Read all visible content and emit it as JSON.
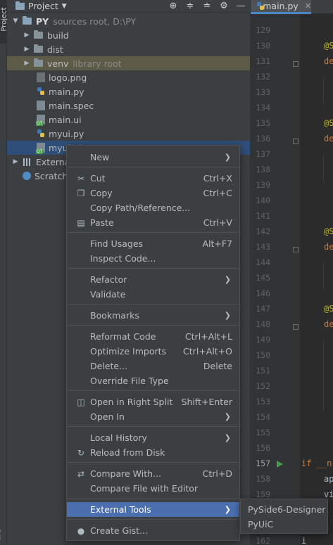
{
  "tool_strip": {
    "project_label": "Project",
    "bottom_label": "ure"
  },
  "panel": {
    "title": "Project",
    "tools": {
      "locate": "⊕",
      "expand": "≑",
      "collapse": "≐",
      "settings": "⚙",
      "hide": "—"
    }
  },
  "tree": {
    "root": {
      "name": "PY",
      "detail": "sources root,  D:\\PY"
    },
    "items": [
      {
        "name": "build"
      },
      {
        "name": "dist"
      },
      {
        "name": "venv",
        "detail": "library root"
      },
      {
        "name": "logo.png"
      },
      {
        "name": "main.py"
      },
      {
        "name": "main.spec"
      },
      {
        "name": "main.ui"
      },
      {
        "name": "myui.py"
      },
      {
        "name": "myui.ui"
      },
      {
        "name": "External Libraries"
      },
      {
        "name": "Scratches and Consoles"
      }
    ]
  },
  "editor": {
    "tab_label": "main.py",
    "line_numbers": [
      "129",
      "130",
      "131",
      "132",
      "133",
      "134",
      "135",
      "136",
      "137",
      "138",
      "139",
      "140",
      "141",
      "142",
      "143",
      "144",
      "145",
      "146",
      "147",
      "148",
      "149",
      "150",
      "151",
      "152",
      "153",
      "154",
      "155",
      "156",
      "157",
      "158",
      "159",
      "160",
      "161",
      "162"
    ],
    "code": {
      "deco": "@S",
      "def": "de",
      "if": "if __n",
      "ap": "ap",
      "vi": "vi",
      "i1": "i",
      "i2": "i",
      "i3": "i",
      "last": "i"
    }
  },
  "context_menu": {
    "items": [
      {
        "label": "New",
        "shortcut": "",
        "submenu": true,
        "icon": ""
      },
      {
        "label": "Cut",
        "shortcut": "Ctrl+X",
        "icon": "cut-icon"
      },
      {
        "label": "Copy",
        "shortcut": "Ctrl+C",
        "icon": "copy-icon"
      },
      {
        "label": "Copy Path/Reference...",
        "shortcut": ""
      },
      {
        "label": "Paste",
        "shortcut": "Ctrl+V",
        "icon": "paste-icon"
      },
      {
        "label": "Find Usages",
        "shortcut": "Alt+F7"
      },
      {
        "label": "Inspect Code...",
        "shortcut": ""
      },
      {
        "label": "Refactor",
        "shortcut": "",
        "submenu": true
      },
      {
        "label": "Validate",
        "shortcut": ""
      },
      {
        "label": "Bookmarks",
        "shortcut": "",
        "submenu": true
      },
      {
        "label": "Reformat Code",
        "shortcut": "Ctrl+Alt+L"
      },
      {
        "label": "Optimize Imports",
        "shortcut": "Ctrl+Alt+O"
      },
      {
        "label": "Delete...",
        "shortcut": "Delete"
      },
      {
        "label": "Override File Type",
        "shortcut": ""
      },
      {
        "label": "Open in Right Split",
        "shortcut": "Shift+Enter",
        "icon": "split-icon"
      },
      {
        "label": "Open In",
        "shortcut": "",
        "submenu": true
      },
      {
        "label": "Local History",
        "shortcut": "",
        "submenu": true
      },
      {
        "label": "Reload from Disk",
        "shortcut": "",
        "icon": "reload-icon"
      },
      {
        "label": "Compare With...",
        "shortcut": "Ctrl+D",
        "icon": "compare-icon"
      },
      {
        "label": "Compare File with Editor",
        "shortcut": ""
      },
      {
        "label": "External Tools",
        "shortcut": "",
        "submenu": true
      },
      {
        "label": "Create Gist...",
        "shortcut": "",
        "icon": "github-icon"
      }
    ],
    "submenu_arrow": "❯"
  },
  "external_tools_submenu": {
    "items": [
      {
        "label": "PySide6-Designer"
      },
      {
        "label": "PyUiC"
      }
    ]
  },
  "colors": {
    "panel_bg": "#3c3f41",
    "editor_bg": "#2b2b2b",
    "selection": "#2f4e79",
    "menu_highlight": "#4b6eaf",
    "excluded_folder": "#5d5a47"
  }
}
